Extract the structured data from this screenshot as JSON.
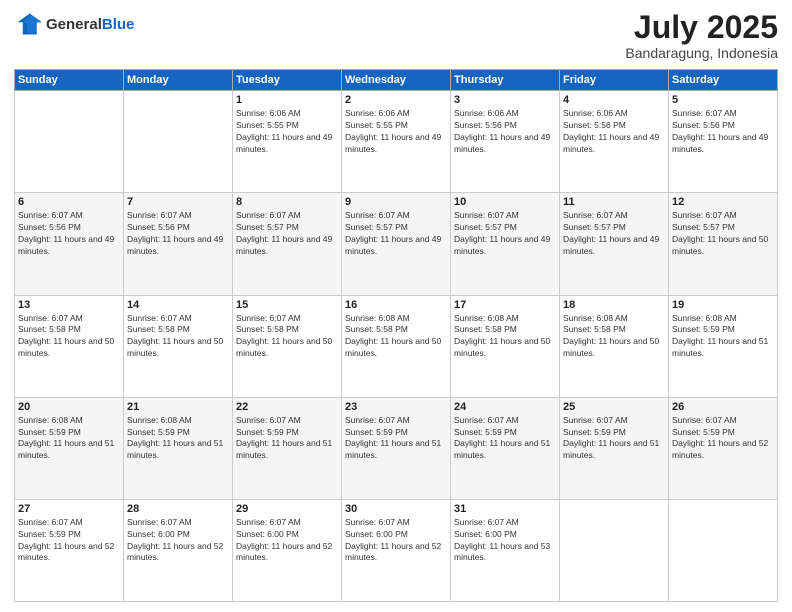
{
  "logo": {
    "general": "General",
    "blue": "Blue"
  },
  "header": {
    "month": "July 2025",
    "location": "Bandaragung, Indonesia"
  },
  "weekdays": [
    "Sunday",
    "Monday",
    "Tuesday",
    "Wednesday",
    "Thursday",
    "Friday",
    "Saturday"
  ],
  "weeks": [
    [
      {
        "day": "",
        "info": ""
      },
      {
        "day": "",
        "info": ""
      },
      {
        "day": "1",
        "info": "Sunrise: 6:06 AM\nSunset: 5:55 PM\nDaylight: 11 hours and 49 minutes."
      },
      {
        "day": "2",
        "info": "Sunrise: 6:06 AM\nSunset: 5:55 PM\nDaylight: 11 hours and 49 minutes."
      },
      {
        "day": "3",
        "info": "Sunrise: 6:06 AM\nSunset: 5:56 PM\nDaylight: 11 hours and 49 minutes."
      },
      {
        "day": "4",
        "info": "Sunrise: 6:06 AM\nSunset: 5:56 PM\nDaylight: 11 hours and 49 minutes."
      },
      {
        "day": "5",
        "info": "Sunrise: 6:07 AM\nSunset: 5:56 PM\nDaylight: 11 hours and 49 minutes."
      }
    ],
    [
      {
        "day": "6",
        "info": "Sunrise: 6:07 AM\nSunset: 5:56 PM\nDaylight: 11 hours and 49 minutes."
      },
      {
        "day": "7",
        "info": "Sunrise: 6:07 AM\nSunset: 5:56 PM\nDaylight: 11 hours and 49 minutes."
      },
      {
        "day": "8",
        "info": "Sunrise: 6:07 AM\nSunset: 5:57 PM\nDaylight: 11 hours and 49 minutes."
      },
      {
        "day": "9",
        "info": "Sunrise: 6:07 AM\nSunset: 5:57 PM\nDaylight: 11 hours and 49 minutes."
      },
      {
        "day": "10",
        "info": "Sunrise: 6:07 AM\nSunset: 5:57 PM\nDaylight: 11 hours and 49 minutes."
      },
      {
        "day": "11",
        "info": "Sunrise: 6:07 AM\nSunset: 5:57 PM\nDaylight: 11 hours and 49 minutes."
      },
      {
        "day": "12",
        "info": "Sunrise: 6:07 AM\nSunset: 5:57 PM\nDaylight: 11 hours and 50 minutes."
      }
    ],
    [
      {
        "day": "13",
        "info": "Sunrise: 6:07 AM\nSunset: 5:58 PM\nDaylight: 11 hours and 50 minutes."
      },
      {
        "day": "14",
        "info": "Sunrise: 6:07 AM\nSunset: 5:58 PM\nDaylight: 11 hours and 50 minutes."
      },
      {
        "day": "15",
        "info": "Sunrise: 6:07 AM\nSunset: 5:58 PM\nDaylight: 11 hours and 50 minutes."
      },
      {
        "day": "16",
        "info": "Sunrise: 6:08 AM\nSunset: 5:58 PM\nDaylight: 11 hours and 50 minutes."
      },
      {
        "day": "17",
        "info": "Sunrise: 6:08 AM\nSunset: 5:58 PM\nDaylight: 11 hours and 50 minutes."
      },
      {
        "day": "18",
        "info": "Sunrise: 6:08 AM\nSunset: 5:58 PM\nDaylight: 11 hours and 50 minutes."
      },
      {
        "day": "19",
        "info": "Sunrise: 6:08 AM\nSunset: 5:59 PM\nDaylight: 11 hours and 51 minutes."
      }
    ],
    [
      {
        "day": "20",
        "info": "Sunrise: 6:08 AM\nSunset: 5:59 PM\nDaylight: 11 hours and 51 minutes."
      },
      {
        "day": "21",
        "info": "Sunrise: 6:08 AM\nSunset: 5:59 PM\nDaylight: 11 hours and 51 minutes."
      },
      {
        "day": "22",
        "info": "Sunrise: 6:07 AM\nSunset: 5:59 PM\nDaylight: 11 hours and 51 minutes."
      },
      {
        "day": "23",
        "info": "Sunrise: 6:07 AM\nSunset: 5:59 PM\nDaylight: 11 hours and 51 minutes."
      },
      {
        "day": "24",
        "info": "Sunrise: 6:07 AM\nSunset: 5:59 PM\nDaylight: 11 hours and 51 minutes."
      },
      {
        "day": "25",
        "info": "Sunrise: 6:07 AM\nSunset: 5:59 PM\nDaylight: 11 hours and 51 minutes."
      },
      {
        "day": "26",
        "info": "Sunrise: 6:07 AM\nSunset: 5:59 PM\nDaylight: 11 hours and 52 minutes."
      }
    ],
    [
      {
        "day": "27",
        "info": "Sunrise: 6:07 AM\nSunset: 5:59 PM\nDaylight: 11 hours and 52 minutes."
      },
      {
        "day": "28",
        "info": "Sunrise: 6:07 AM\nSunset: 6:00 PM\nDaylight: 11 hours and 52 minutes."
      },
      {
        "day": "29",
        "info": "Sunrise: 6:07 AM\nSunset: 6:00 PM\nDaylight: 11 hours and 52 minutes."
      },
      {
        "day": "30",
        "info": "Sunrise: 6:07 AM\nSunset: 6:00 PM\nDaylight: 11 hours and 52 minutes."
      },
      {
        "day": "31",
        "info": "Sunrise: 6:07 AM\nSunset: 6:00 PM\nDaylight: 11 hours and 53 minutes."
      },
      {
        "day": "",
        "info": ""
      },
      {
        "day": "",
        "info": ""
      }
    ]
  ]
}
